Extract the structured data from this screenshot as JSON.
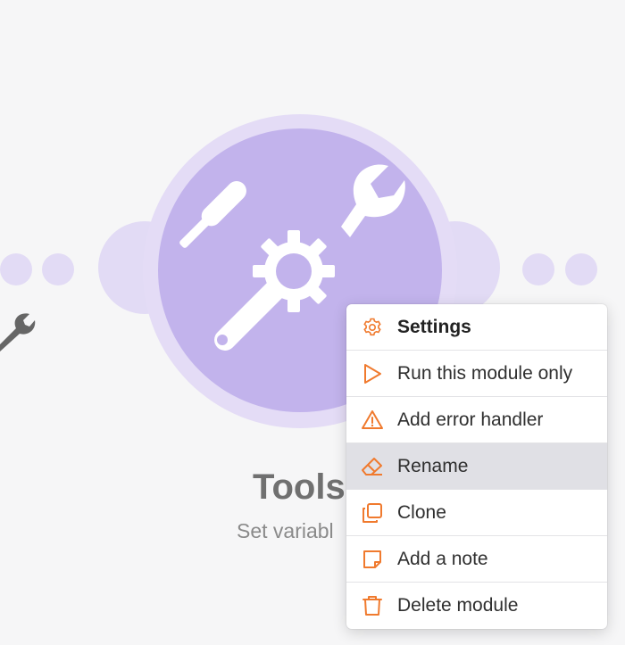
{
  "colors": {
    "module_fill": "#c2b3ec",
    "halo": "#e4dcf6",
    "icon_accent": "#f07a2e",
    "hover": "#e0e0e5"
  },
  "module": {
    "title": "Tools",
    "subtitle": "Set variabl",
    "icon": "tools-icon"
  },
  "context_menu": {
    "items": [
      {
        "label": "Settings",
        "icon": "gear-icon"
      },
      {
        "label": "Run this module only",
        "icon": "play-icon"
      },
      {
        "label": "Add error handler",
        "icon": "warning-icon"
      },
      {
        "label": "Rename",
        "icon": "eraser-icon",
        "hovered": true
      },
      {
        "label": "Clone",
        "icon": "clone-icon"
      },
      {
        "label": "Add a note",
        "icon": "note-icon"
      },
      {
        "label": "Delete module",
        "icon": "trash-icon"
      }
    ]
  }
}
